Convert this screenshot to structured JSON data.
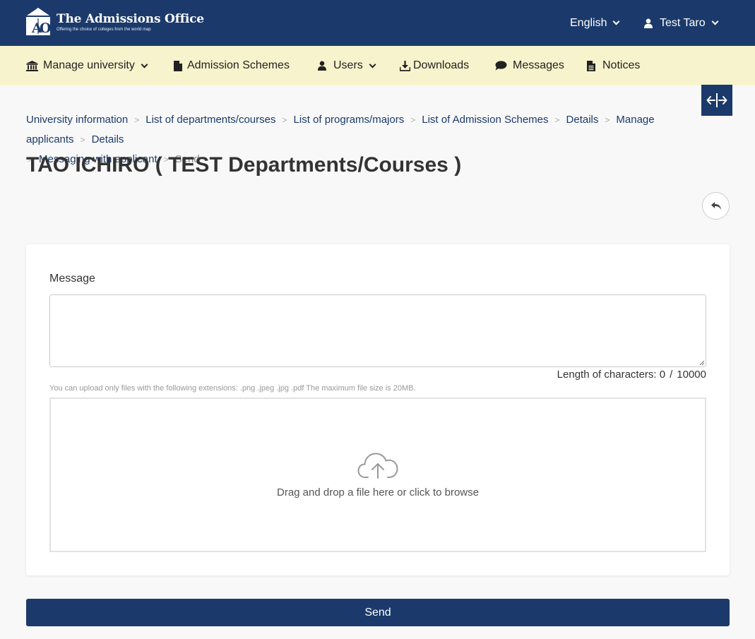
{
  "header": {
    "logo_title": "The Admissions Office",
    "logo_subtitle": "Offering the choice of colleges from the world map",
    "logo_mark_letters": "A O",
    "language": "English",
    "user": "Test Taro"
  },
  "nav": {
    "items": [
      {
        "label": "Manage university",
        "icon": "university-icon",
        "dropdown": true
      },
      {
        "label": "Admission Schemes",
        "icon": "document-icon",
        "dropdown": false
      },
      {
        "label": "Users",
        "icon": "user-icon",
        "dropdown": true
      },
      {
        "label": "Downloads",
        "icon": "download-icon",
        "dropdown": false
      },
      {
        "label": "Messages",
        "icon": "chat-bubble-icon",
        "dropdown": false
      },
      {
        "label": "Notices",
        "icon": "notice-document-icon",
        "dropdown": false
      }
    ]
  },
  "breadcrumb": {
    "items": [
      "University information",
      "List of departments/courses",
      "List of programs/majors",
      "List of Admission Schemes",
      "Details",
      "Manage applicants",
      "Details",
      "Messaging with applicant"
    ],
    "current": "Send",
    "separator": ">"
  },
  "page": {
    "title": "TAO ICHIRO ( TEST Departments/Courses )"
  },
  "form": {
    "message_label": "Message",
    "message_value": "",
    "counter_label": "Length of characters:",
    "counter_current": "0",
    "counter_slash": "/",
    "counter_max": "10000",
    "upload_note": "You can upload only files with the following extensions: .png .jpeg .jpg .pdf The maximum file size is 20MB.",
    "dropzone_text": "Drag and drop a file here or click to browse",
    "send_label": "Send"
  },
  "colors": {
    "primary": "#1b3a6b",
    "nav_bg": "#f7f3cc",
    "page_bg": "#f8f8f8"
  }
}
